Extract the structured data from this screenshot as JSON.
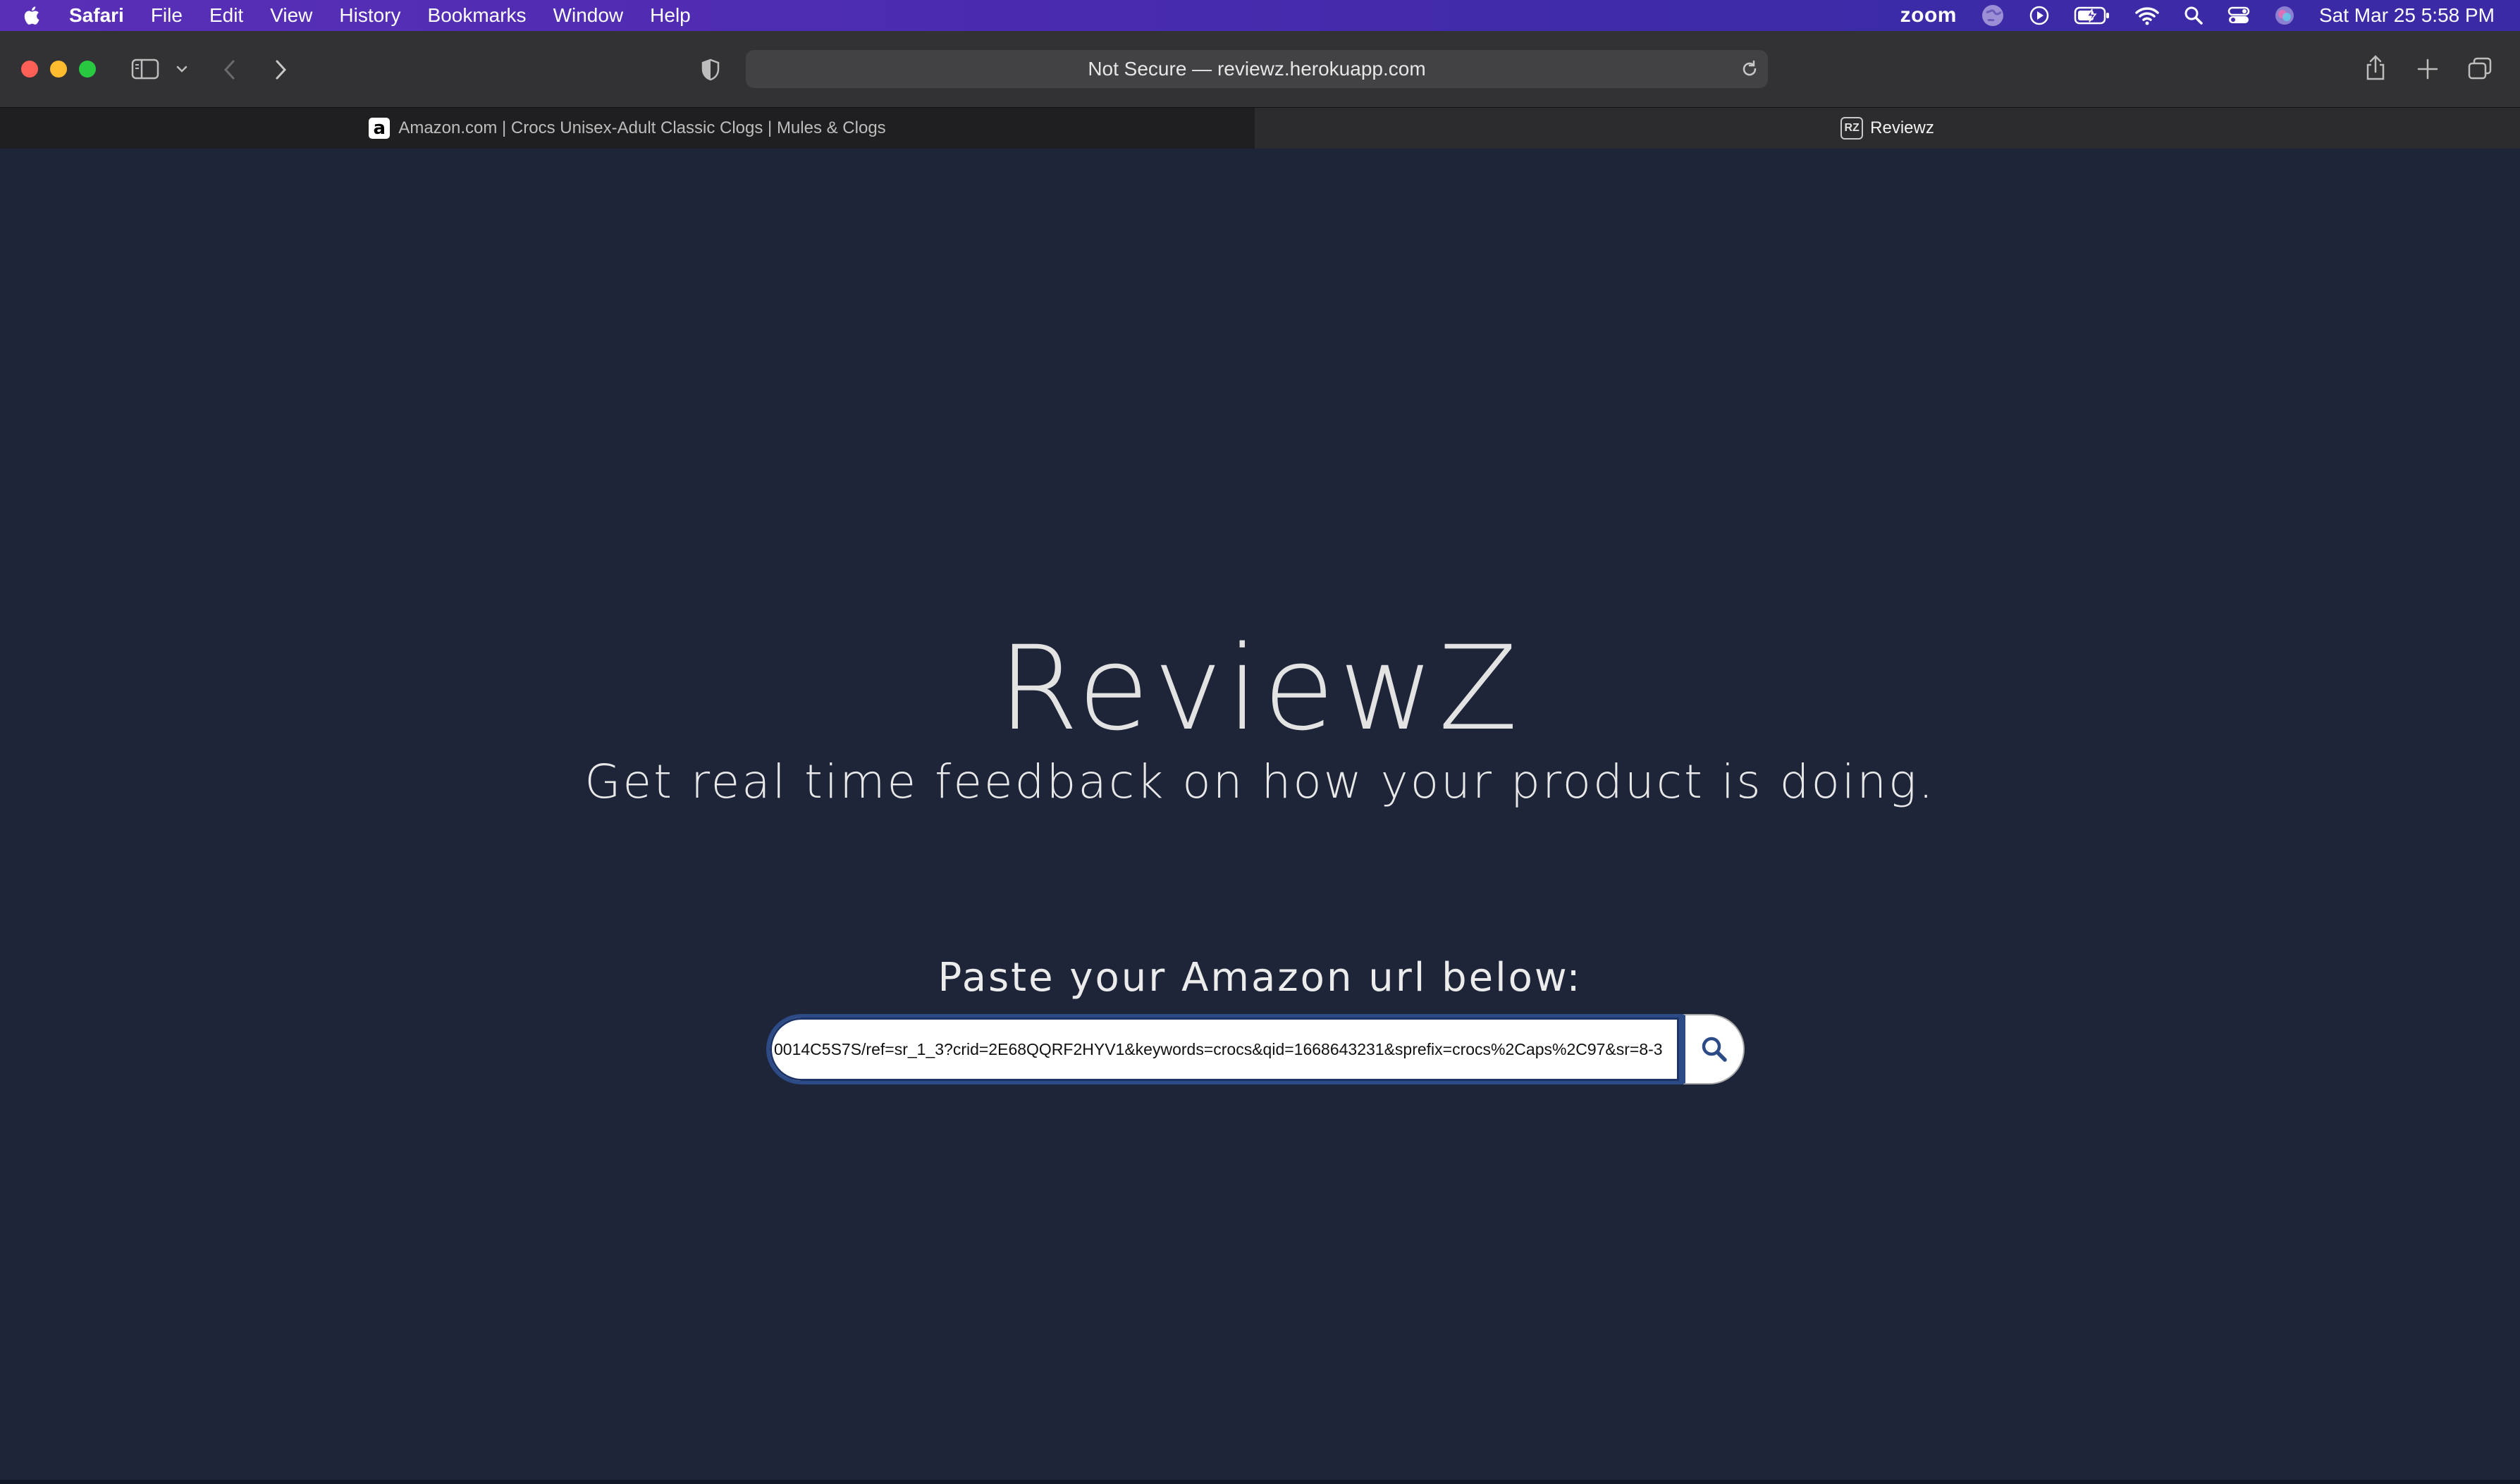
{
  "menubar": {
    "app_name": "Safari",
    "items": [
      "File",
      "Edit",
      "View",
      "History",
      "Bookmarks",
      "Window",
      "Help"
    ],
    "zoom_label": "zoom",
    "datetime": "Sat Mar 25  5:58 PM",
    "status_icons": [
      "globe-icon",
      "play-icon",
      "battery-icon",
      "wifi-icon",
      "search-icon",
      "control-center-icon",
      "siri-icon"
    ]
  },
  "browser": {
    "address": "Not Secure — reviewz.herokuapp.com",
    "tabs": [
      {
        "label": "Amazon.com | Crocs Unisex-Adult Classic Clogs | Mules & Clogs",
        "favicon": "a",
        "active": false
      },
      {
        "label": "Reviewz",
        "favicon": "RZ",
        "active": true
      }
    ]
  },
  "page": {
    "title": "ReviewZ",
    "subtitle": "Get real time feedback on how your product is doing.",
    "paste_label": "Paste your Amazon url below:",
    "url_value": "0014C5S7S/ref=sr_1_3?crid=2E68QQRF2HYV1&keywords=crocs&qid=1668643231&sprefix=crocs%2Caps%2C97&sr=8-3",
    "search_icon": "magnifier-icon"
  },
  "colors": {
    "page_bg": "#1e2538",
    "menubar_bg": "#4a2bb0",
    "toolbar_bg": "#323234",
    "input_border": "#2c4a86",
    "text": "#e3e3e3"
  }
}
